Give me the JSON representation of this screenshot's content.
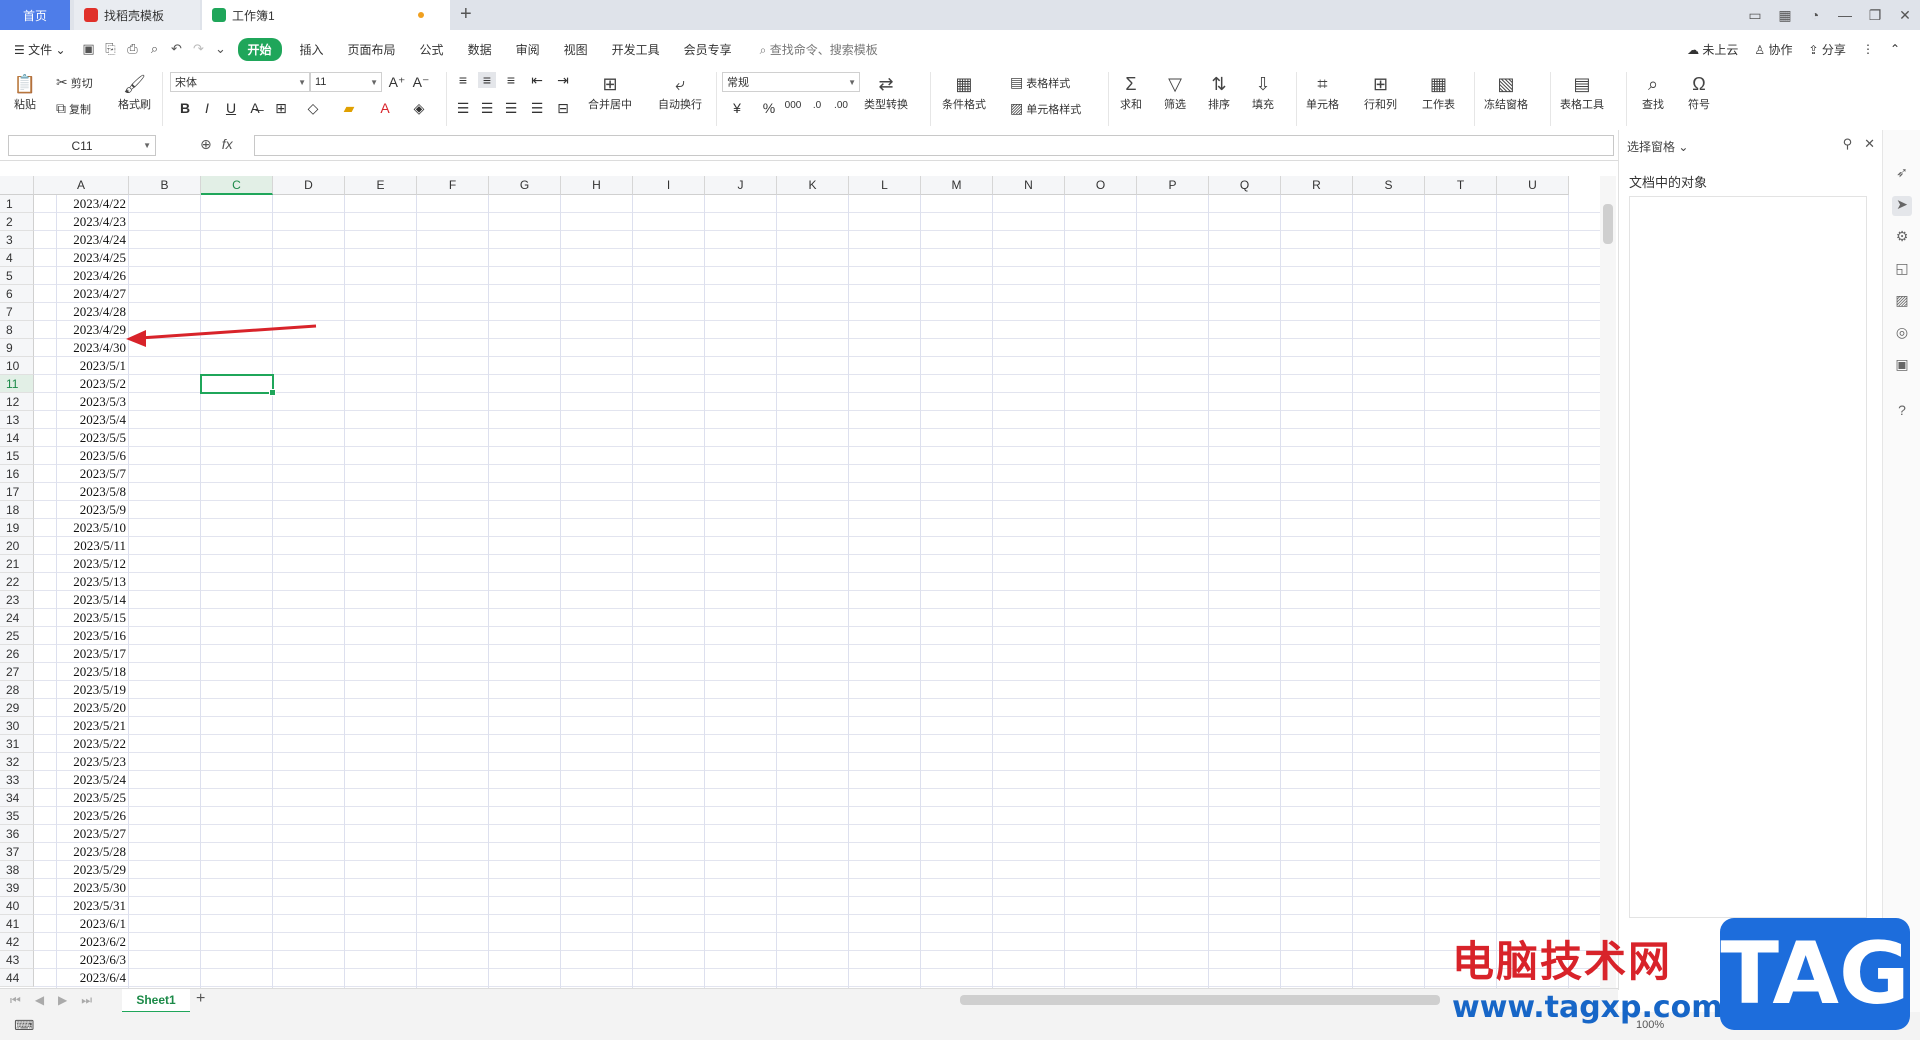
{
  "tabs": {
    "home": "首页",
    "template_tab": "找稻壳模板",
    "workbook_tab": "工作簿1",
    "add": "+"
  },
  "window_controls": [
    "1⃣",
    "▦",
    "◔",
    "—",
    "❐",
    "✕"
  ],
  "menu": {
    "file": "文件",
    "items": [
      "开始",
      "插入",
      "页面布局",
      "公式",
      "数据",
      "审阅",
      "视图",
      "开发工具",
      "会员专享"
    ],
    "search": "查找命令、搜索模板",
    "right": [
      "未上云",
      "协作",
      "分享"
    ]
  },
  "ribbon": {
    "paste": "粘贴",
    "cut": "剪切",
    "copy": "复制",
    "format_painter": "格式刷",
    "font_name": "宋体",
    "font_size": "11",
    "merge_center": "合并居中",
    "wrap_text": "自动换行",
    "number_format": "常规",
    "type_convert": "类型转换",
    "cond_format": "条件格式",
    "table_style": "表格样式",
    "cell_style": "单元格样式",
    "sum": "求和",
    "filter": "筛选",
    "sort": "排序",
    "fill": "填充",
    "cell": "单元格",
    "row_col": "行和列",
    "worksheet": "工作表",
    "freeze": "冻结窗格",
    "table_tools": "表格工具",
    "find": "查找",
    "symbol": "符号"
  },
  "formula_bar": {
    "name_box": "C11",
    "fx": "fx",
    "value": ""
  },
  "grid": {
    "columns": [
      "A",
      "B",
      "C",
      "D",
      "E",
      "F",
      "G",
      "H",
      "I",
      "J",
      "K",
      "L",
      "M",
      "N",
      "O",
      "P",
      "Q",
      "R",
      "S",
      "T",
      "U"
    ],
    "selected_column": "C",
    "selected_row": 11,
    "rows": [
      "2023/4/22",
      "2023/4/23",
      "2023/4/24",
      "2023/4/25",
      "2023/4/26",
      "2023/4/27",
      "2023/4/28",
      "2023/4/29",
      "2023/4/30",
      "2023/5/1",
      "2023/5/2",
      "2023/5/3",
      "2023/5/4",
      "2023/5/5",
      "2023/5/6",
      "2023/5/7",
      "2023/5/8",
      "2023/5/9",
      "2023/5/10",
      "2023/5/11",
      "2023/5/12",
      "2023/5/13",
      "2023/5/14",
      "2023/5/15",
      "2023/5/16",
      "2023/5/17",
      "2023/5/18",
      "2023/5/19",
      "2023/5/20",
      "2023/5/21",
      "2023/5/22",
      "2023/5/23",
      "2023/5/24",
      "2023/5/25",
      "2023/5/26",
      "2023/5/27",
      "2023/5/28",
      "2023/5/29",
      "2023/5/30",
      "2023/5/31",
      "2023/6/1",
      "2023/6/2",
      "2023/6/3",
      "2023/6/4"
    ]
  },
  "right_pane": {
    "title": "选择窗格",
    "subtitle": "文档中的对象"
  },
  "sheet_tabs": [
    "Sheet1"
  ],
  "status": {
    "zoom": "100%"
  },
  "watermark": {
    "site_cn": "电脑技术网",
    "url": "www.tagxp.com",
    "logo": "TAG"
  },
  "colors": {
    "accent_green": "#1fa65a",
    "home_tab_blue": "#4e7de9",
    "arrow_red": "#d8232a"
  }
}
